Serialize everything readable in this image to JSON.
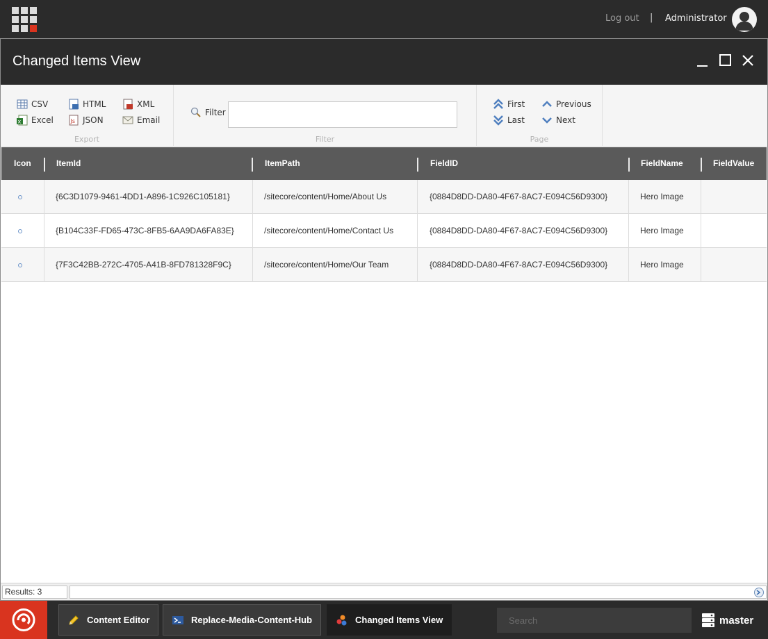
{
  "topbar": {
    "logout_label": "Log out",
    "separator": "|",
    "user_name": "Administrator"
  },
  "window": {
    "title": "Changed Items View"
  },
  "ribbon": {
    "export": {
      "label": "Export",
      "csv": "CSV",
      "excel": "Excel",
      "html": "HTML",
      "json": "JSON",
      "xml": "XML",
      "email": "Email"
    },
    "filter": {
      "label": "Filter",
      "button_label": "Filter",
      "value": ""
    },
    "page": {
      "label": "Page",
      "first": "First",
      "last": "Last",
      "previous": "Previous",
      "next": "Next"
    }
  },
  "grid": {
    "columns": [
      "Icon",
      "ItemId",
      "ItemPath",
      "FieldID",
      "FieldName",
      "FieldValue"
    ],
    "rows": [
      {
        "item_id": "{6C3D1079-9461-4DD1-A896-1C926C105181}",
        "item_path": "/sitecore/content/Home/About Us",
        "field_id": "{0884D8DD-DA80-4F67-8AC7-E094C56D9300}",
        "field_name": "Hero Image",
        "field_value": ""
      },
      {
        "item_id": "{B104C33F-FD65-473C-8FB5-6AA9DA6FA83E}",
        "item_path": "/sitecore/content/Home/Contact Us",
        "field_id": "{0884D8DD-DA80-4F67-8AC7-E094C56D9300}",
        "field_name": "Hero Image",
        "field_value": ""
      },
      {
        "item_id": "{7F3C42BB-272C-4705-A41B-8FD781328F9C}",
        "item_path": "/sitecore/content/Home/Our Team",
        "field_id": "{0884D8DD-DA80-4F67-8AC7-E094C56D9300}",
        "field_name": "Hero Image",
        "field_value": ""
      }
    ]
  },
  "status": {
    "results": "Results: 3"
  },
  "taskbar": {
    "tasks": [
      "Content Editor",
      "Replace-Media-Content-Hub",
      "Changed Items View"
    ],
    "search_placeholder": "Search",
    "database": "master"
  },
  "colors": {
    "dark_bg": "#2b2b2b",
    "sitecore_red": "#d9341f",
    "grid_header": "#5a5a5a"
  }
}
